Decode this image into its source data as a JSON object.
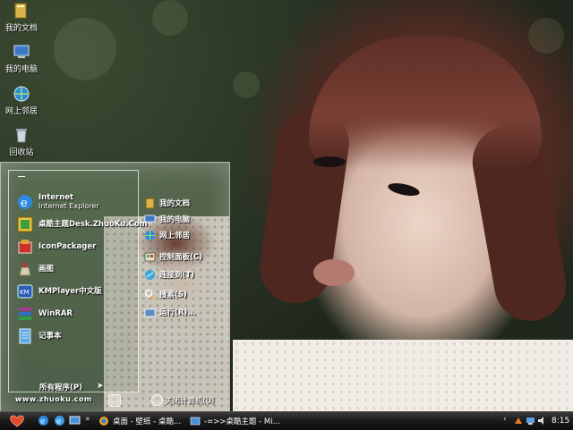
{
  "desktop_icons": [
    {
      "label": "我的文档",
      "icon": "folder-icon"
    },
    {
      "label": "我的电脑",
      "icon": "computer-icon"
    },
    {
      "label": "网上邻居",
      "icon": "network-icon"
    },
    {
      "label": "回收站",
      "icon": "recycle-bin-icon"
    }
  ],
  "start_menu": {
    "programs": [
      {
        "title": "Internet",
        "subtitle": "Internet Explorer",
        "icon": "internet-explorer-icon"
      },
      {
        "title": "桌酷主题Desk.ZhuoKu.Com",
        "subtitle": "",
        "icon": "zhuoku-icon"
      },
      {
        "title": "IconPackager",
        "subtitle": "",
        "icon": "iconpackager-icon"
      },
      {
        "title": "画图",
        "subtitle": "",
        "icon": "paint-icon"
      },
      {
        "title": "KMPlayer中文版",
        "subtitle": "",
        "icon": "kmplayer-icon"
      },
      {
        "title": "WinRAR",
        "subtitle": "",
        "icon": "winrar-icon"
      },
      {
        "title": "记事本",
        "subtitle": "",
        "icon": "notepad-icon"
      }
    ],
    "all_programs": "所有程序(P)",
    "places": [
      {
        "label": "我的文档",
        "icon": "folder-icon"
      },
      {
        "label": "我的电脑",
        "icon": "computer-icon"
      },
      {
        "label": "网上邻居",
        "icon": "network-icon"
      },
      {
        "label": "控制面板(C)",
        "icon": "control-panel-icon"
      },
      {
        "label": "连接到(T)",
        "icon": "connect-icon"
      },
      {
        "label": "搜索(S)",
        "icon": "search-icon"
      },
      {
        "label": "运行(R)...",
        "icon": "run-icon"
      }
    ],
    "website": "www.zhuoku.com",
    "shutdown_label": "关闭计算机(U)"
  },
  "taskbar": {
    "tasks": [
      {
        "label": "桌面 - 壁纸 - 桌酷...",
        "icon": "browser-icon"
      },
      {
        "label": "-=>>桌酷主题 - Mi...",
        "icon": "window-icon"
      }
    ],
    "clock": "8:15"
  },
  "colors": {
    "taskbar": "#1c1c1c",
    "menu_border": "#ffffff",
    "hair": "#5c2f26"
  }
}
